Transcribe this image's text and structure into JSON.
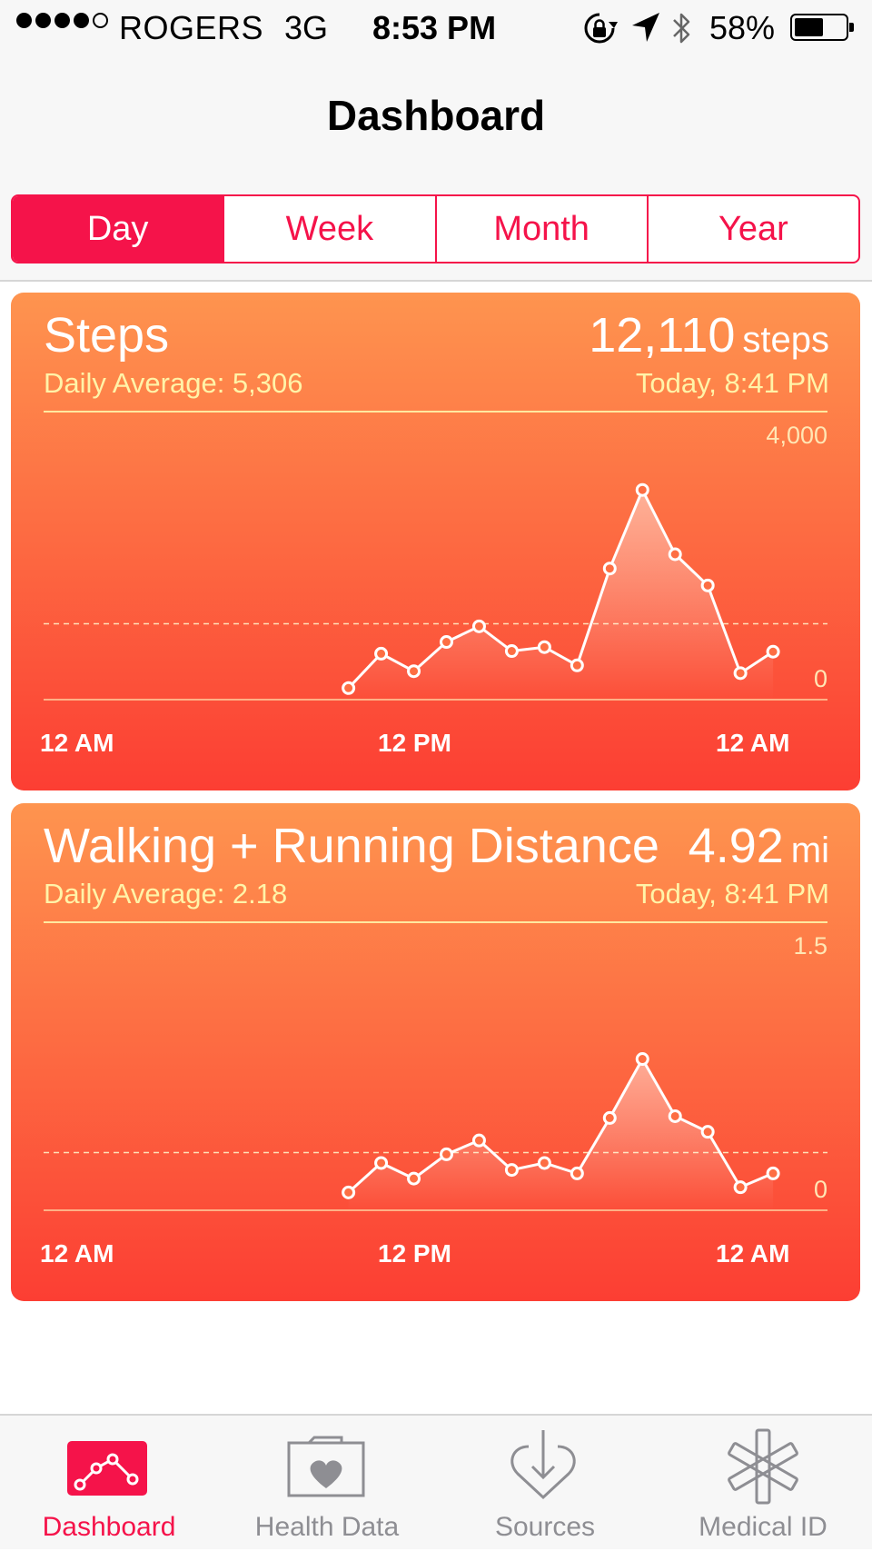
{
  "status_bar": {
    "carrier": "ROGERS",
    "network": "3G",
    "time": "8:53 PM",
    "battery_percent": "58%",
    "battery_level": 0.58,
    "signal_bars_filled": 4,
    "signal_bars_total": 5,
    "icons": [
      "orientation-lock-icon",
      "location-arrow-icon",
      "bluetooth-icon",
      "battery-icon"
    ]
  },
  "nav": {
    "title": "Dashboard",
    "segments": [
      "Day",
      "Week",
      "Month",
      "Year"
    ],
    "selected_segment": "Day"
  },
  "accent_color": "#f5134a",
  "cards": [
    {
      "title": "Steps",
      "value": "12,110",
      "unit": "steps",
      "average": "Daily Average: 5,306",
      "timestamp": "Today, 8:41 PM",
      "y_max_label": "4,000",
      "y_min_label": "0",
      "x_labels": [
        "12 AM",
        "12 PM",
        "12 AM"
      ]
    },
    {
      "title": "Walking + Running Distance",
      "value": "4.92",
      "unit": "mi",
      "average": "Daily Average: 2.18",
      "timestamp": "Today, 8:41 PM",
      "y_max_label": "1.5",
      "y_min_label": "0",
      "x_labels": [
        "12 AM",
        "12 PM",
        "12 AM"
      ]
    }
  ],
  "chart_data": [
    {
      "type": "area",
      "title": "Steps",
      "x": [
        9,
        10,
        11,
        12,
        13,
        14,
        15,
        16,
        17,
        18,
        19,
        20,
        21,
        22,
        23
      ],
      "values": [
        10,
        540,
        270,
        720,
        960,
        580,
        640,
        360,
        1850,
        3060,
        2070,
        1590,
        240,
        570
      ],
      "x_hours": [
        9,
        10,
        11,
        12,
        13,
        14,
        15,
        16,
        17,
        18,
        19,
        20,
        21,
        22
      ],
      "xlim": [
        0,
        24
      ],
      "ylim": [
        0,
        4000
      ],
      "average": 1000,
      "xlabel": "",
      "ylabel": ""
    },
    {
      "type": "area",
      "title": "Walking + Running Distance",
      "x_hours": [
        9,
        10,
        11,
        12,
        13,
        14,
        15,
        16,
        17,
        18,
        19,
        20,
        21,
        22
      ],
      "values": [
        0.04,
        0.21,
        0.12,
        0.26,
        0.34,
        0.17,
        0.21,
        0.15,
        0.47,
        0.81,
        0.48,
        0.39,
        0.07,
        0.15
      ],
      "xlim": [
        0,
        24
      ],
      "ylim": [
        0,
        1.5
      ],
      "average": 0.27,
      "xlabel": "",
      "ylabel": ""
    }
  ],
  "tabs": [
    {
      "label": "Dashboard",
      "icon": "dashboard-chart-icon",
      "active": true
    },
    {
      "label": "Health Data",
      "icon": "health-data-folder-icon",
      "active": false
    },
    {
      "label": "Sources",
      "icon": "sources-heart-arrow-icon",
      "active": false
    },
    {
      "label": "Medical ID",
      "icon": "medical-id-asterisk-icon",
      "active": false
    }
  ]
}
